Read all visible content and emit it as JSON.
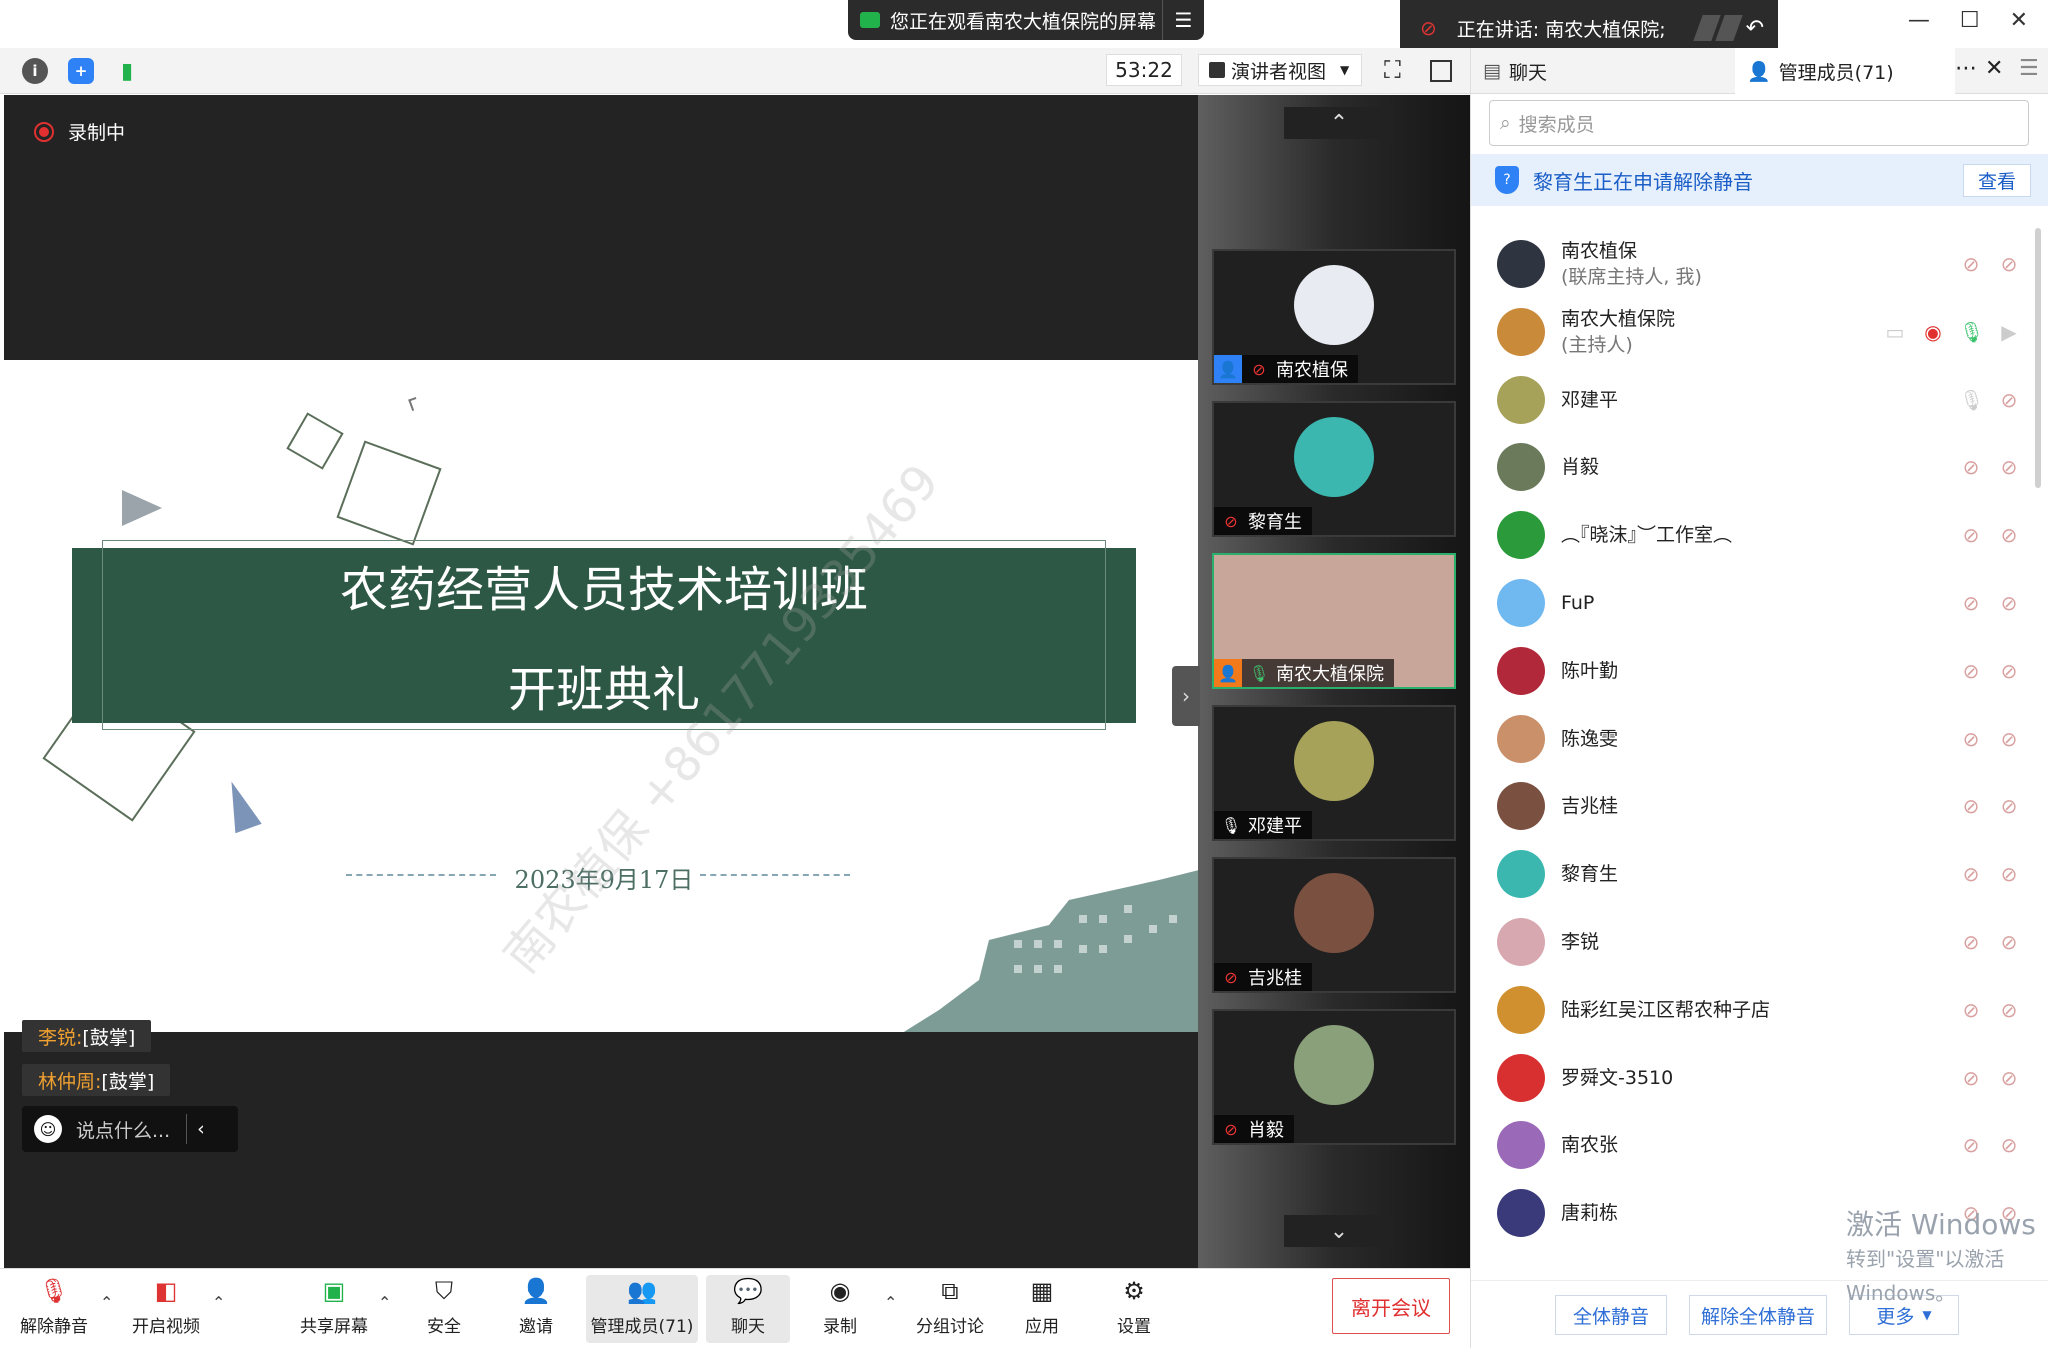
{
  "share_banner": "您正在观看南农大植保院的屏幕",
  "speaker_banner": "正在讲话: 南农大植保院;",
  "toolbar": {
    "timer": "53:22",
    "view_mode": "演讲者视图"
  },
  "recording_label": "录制中",
  "slide": {
    "title": "农药经营人员技术培训班",
    "subtitle": "开班典礼",
    "date": "2023年9月17日",
    "watermark": "南农植保 +8617719335469"
  },
  "reactions": [
    {
      "name": "李锐:",
      "text": "[鼓掌]"
    },
    {
      "name": "林仲周:",
      "text": "[鼓掌]"
    }
  ],
  "chat_placeholder": "说点什么...",
  "gallery": [
    {
      "name": "南农植保",
      "host": true,
      "host_color": "blue",
      "mic": "muted",
      "avatar_color": "#e8ecf2",
      "active": false
    },
    {
      "name": "黎育生",
      "host": false,
      "mic": "muted",
      "avatar_color": "#3bb7b0",
      "active": false
    },
    {
      "name": "南农大植保院",
      "host": true,
      "host_color": "orange",
      "mic": "on",
      "avatar_color": "#c9a69a",
      "active": true
    },
    {
      "name": "邓建平",
      "host": false,
      "mic": "white",
      "avatar_color": "#a6a25a",
      "active": false
    },
    {
      "name": "吉兆桂",
      "host": false,
      "mic": "muted",
      "avatar_color": "#7a5040",
      "active": false
    },
    {
      "name": "肖毅",
      "host": false,
      "mic": "muted",
      "avatar_color": "#8aa07a",
      "active": false
    }
  ],
  "panel": {
    "chat_tab": "聊天",
    "members_tab": "管理成员(71)",
    "search_placeholder": "搜索成员",
    "notice": "黎育生正在申请解除静音",
    "notice_action": "查看",
    "members": [
      {
        "name": "南农植保",
        "role": "(联席主持人, 我)",
        "color": "#2e3440",
        "state": "muted"
      },
      {
        "name": "南农大植保院",
        "role": "(主持人)",
        "color": "#c98a3a",
        "state": "host"
      },
      {
        "name": "邓建平",
        "role": "",
        "color": "#a6a25a",
        "state": "idle"
      },
      {
        "name": "肖毅",
        "role": "",
        "color": "#6a7a5a",
        "state": "muted"
      },
      {
        "name": "︵『晓沫』︶工作室︵",
        "role": "",
        "color": "#2a9a3a",
        "state": "muted"
      },
      {
        "name": "FuP",
        "role": "",
        "color": "#6fb8f0",
        "state": "muted"
      },
      {
        "name": "陈叶勤",
        "role": "",
        "color": "#b0283a",
        "state": "muted"
      },
      {
        "name": "陈逸雯",
        "role": "",
        "color": "#c9906a",
        "state": "muted"
      },
      {
        "name": "吉兆桂",
        "role": "",
        "color": "#7a5040",
        "state": "muted"
      },
      {
        "name": "黎育生",
        "role": "",
        "color": "#3bb7b0",
        "state": "muted"
      },
      {
        "name": "李锐",
        "role": "",
        "color": "#d8a8b0",
        "state": "muted"
      },
      {
        "name": "陆彩红吴江区帮农种子店",
        "role": "",
        "color": "#d09030",
        "state": "muted"
      },
      {
        "name": "罗舜文-3510",
        "role": "",
        "color": "#d83030",
        "state": "muted"
      },
      {
        "name": "南农张",
        "role": "",
        "color": "#9a6ab8",
        "state": "muted"
      },
      {
        "name": "唐莉栋",
        "role": "",
        "color": "#3a3a7a",
        "state": "muted"
      }
    ],
    "mute_all": "全体静音",
    "unmute_all": "解除全体静音",
    "more": "更多"
  },
  "windows_watermark": {
    "line1": "激活 Windows",
    "line2": "转到\"设置\"以激活 Windows。"
  },
  "bottom": {
    "unmute": "解除静音",
    "video": "开启视频",
    "share": "共享屏幕",
    "security": "安全",
    "invite": "邀请",
    "members": "管理成员(71)",
    "chat": "聊天",
    "record": "录制",
    "breakout": "分组讨论",
    "apps": "应用",
    "settings": "设置",
    "leave": "离开会议"
  }
}
